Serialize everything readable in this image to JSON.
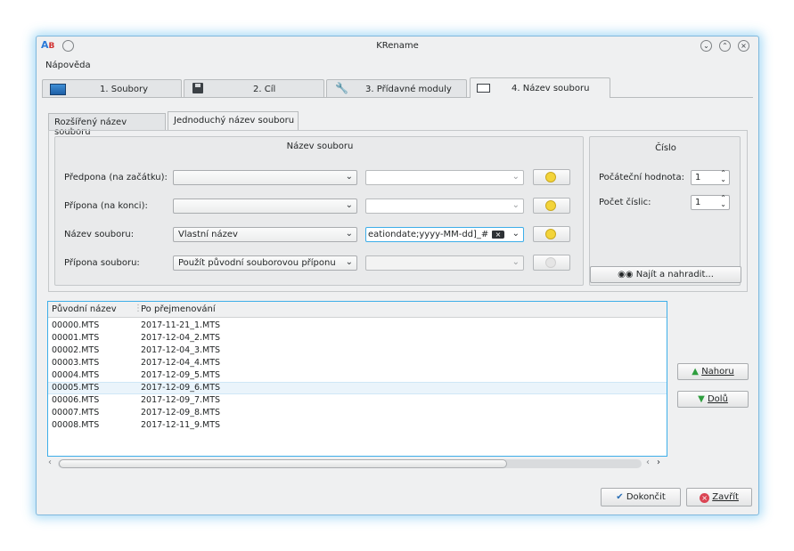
{
  "window": {
    "title": "KRename",
    "app_icon_a": "A",
    "app_icon_b": "B",
    "controls": [
      "minimize-icon",
      "maximize-icon",
      "close-icon"
    ]
  },
  "menubar": {
    "help": "Nápověda"
  },
  "tabs": [
    {
      "num": "1.",
      "label": "Soubory",
      "icon": "monitor-icon"
    },
    {
      "num": "2.",
      "label": "Cíl",
      "icon": "floppy-disk-icon"
    },
    {
      "num": "3.",
      "label": "Přídavné moduly",
      "icon": "wrench-icon"
    },
    {
      "num": "4.",
      "label": "Název souboru",
      "icon": "textfield-icon",
      "active": true
    }
  ],
  "subtabs": [
    {
      "label": "Rozšířený název souboru"
    },
    {
      "label": "Jednoduchý název souboru",
      "active": true
    }
  ],
  "filename_group": {
    "title": "Název souboru",
    "rows": [
      {
        "label": "Předpona (na začátku):",
        "combo": "",
        "edit": "",
        "bulb_enabled": true
      },
      {
        "label": "Přípona (na konci):",
        "combo": "",
        "edit": "",
        "bulb_enabled": true
      },
      {
        "label": "Název souboru:",
        "combo": "Vlastní název",
        "edit": "eationdate;yyyy-MM-dd]_#",
        "bulb_enabled": true
      },
      {
        "label": "Přípona souboru:",
        "combo": "Použít původní souborovou příponu",
        "edit": "",
        "bulb_enabled": false
      }
    ]
  },
  "number_group": {
    "title": "Číslo",
    "start_label": "Počáteční hodnota:",
    "start_value": "1",
    "digits_label": "Počet číslic:",
    "digits_value": "1",
    "find_replace": "Najít a nahradit..."
  },
  "file_list": {
    "headers": [
      "Původní název",
      "Po přejmenování"
    ],
    "rows": [
      [
        "00000.MTS",
        "2017-11-21_1.MTS"
      ],
      [
        "00001.MTS",
        "2017-12-04_2.MTS"
      ],
      [
        "00002.MTS",
        "2017-12-04_3.MTS"
      ],
      [
        "00003.MTS",
        "2017-12-04_4.MTS"
      ],
      [
        "00004.MTS",
        "2017-12-09_5.MTS"
      ],
      [
        "00005.MTS",
        "2017-12-09_6.MTS"
      ],
      [
        "00006.MTS",
        "2017-12-09_7.MTS"
      ],
      [
        "00007.MTS",
        "2017-12-09_8.MTS"
      ],
      [
        "00008.MTS",
        "2017-12-11_9.MTS"
      ]
    ]
  },
  "side_buttons": {
    "up": "Nahoru",
    "down": "Dolů"
  },
  "bottom_buttons": {
    "finish": "Dokončit",
    "close": "Zavřít"
  },
  "colors": {
    "accent": "#3daee9",
    "up_arrow": "#2e9e3e",
    "close_red": "#da4453"
  }
}
